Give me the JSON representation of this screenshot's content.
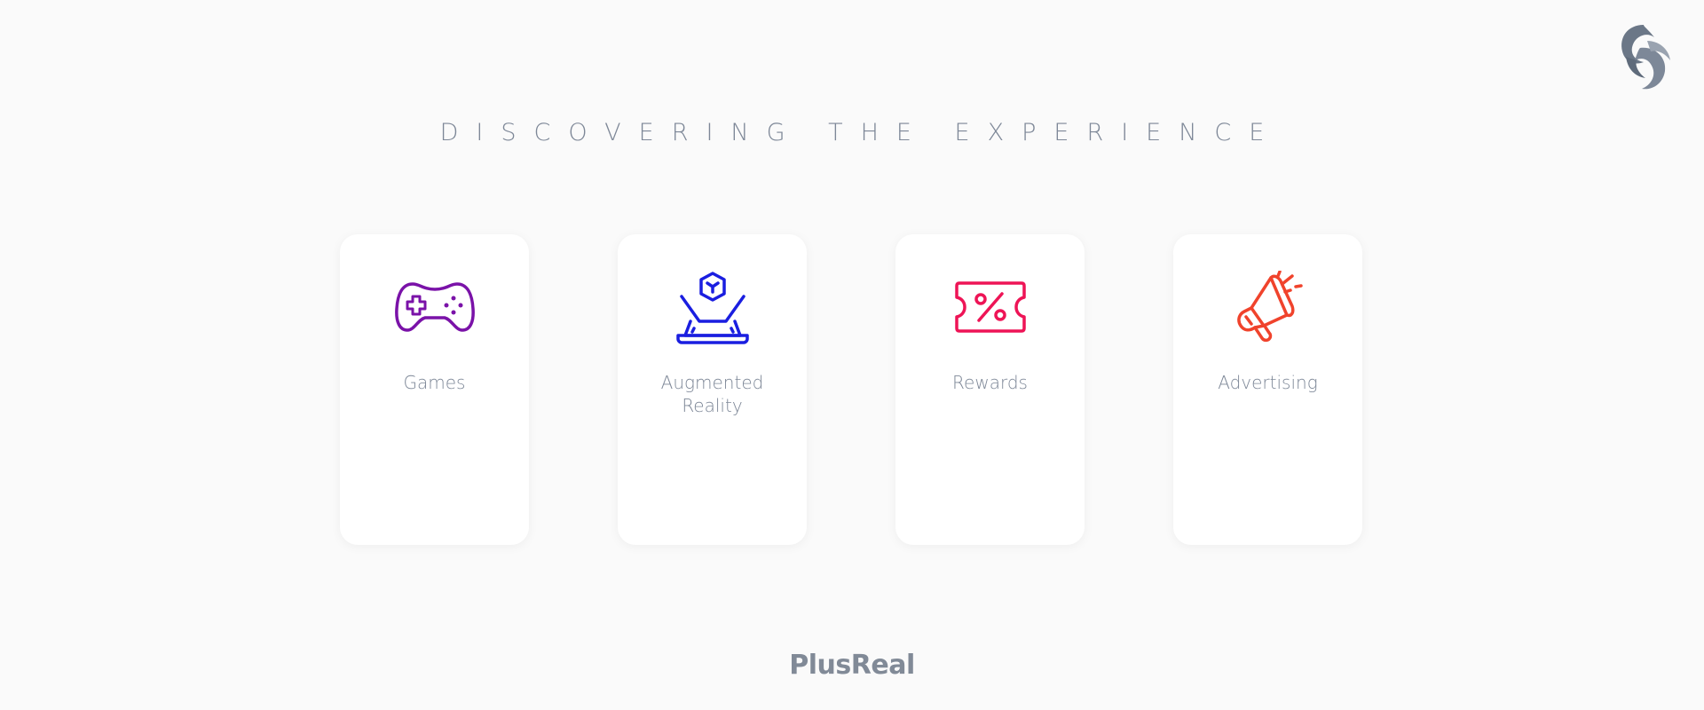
{
  "page": {
    "title": "DISCOVERING THE EXPERIENCE",
    "brand": "PlusReal"
  },
  "logo": {
    "icon": "phoenix-logo-icon",
    "color": "#6b7787"
  },
  "cards": [
    {
      "label": "Games",
      "icon": "gamepad-icon",
      "color": "#7a12a8"
    },
    {
      "label": "Augmented Reality",
      "icon": "hologram-cube-icon",
      "color": "#1a1ee0"
    },
    {
      "label": "Rewards",
      "icon": "ticket-percent-icon",
      "color": "#ee1456"
    },
    {
      "label": "Advertising",
      "icon": "megaphone-icon",
      "color": "#f0432c"
    }
  ],
  "colors": {
    "background": "#fafafa",
    "card_background": "#ffffff",
    "text": "#7d8797"
  }
}
